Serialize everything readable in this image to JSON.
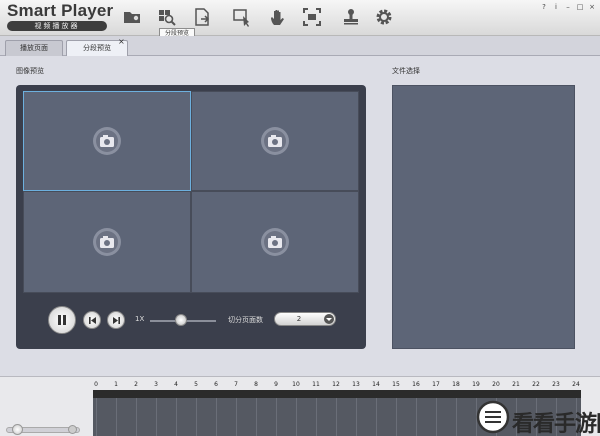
{
  "app": {
    "title": "Smart Player",
    "subtitle": "视频播放器"
  },
  "toolbar": {
    "tools": [
      "open-folder-icon",
      "segment-preview-icon",
      "export-file-icon",
      "select-window-icon",
      "hand-icon",
      "fullscreen-icon",
      "stamp-icon",
      "settings-icon"
    ],
    "tooltip": "分段预览"
  },
  "window_controls": [
    "?",
    "i",
    "–",
    "□",
    "×"
  ],
  "tabs": [
    {
      "label": "播放页面",
      "active": false
    },
    {
      "label": "分段预览",
      "active": true,
      "close": "×"
    }
  ],
  "main": {
    "preview_label": "图像预览",
    "file_label": "文件选择",
    "grid": {
      "cells": 4,
      "selected_index": 0
    }
  },
  "controls": {
    "speed_label": "1X",
    "speed_value_fraction": 0.47,
    "split_label": "切分页面数",
    "split_value": "2"
  },
  "timeline": {
    "ticks": [
      "0",
      "1",
      "2",
      "3",
      "4",
      "5",
      "6",
      "7",
      "8",
      "9",
      "10",
      "11",
      "12",
      "13",
      "14",
      "15",
      "16",
      "17",
      "18",
      "19",
      "20",
      "21",
      "22",
      "23",
      "24"
    ],
    "zoom_fraction": 0.15
  },
  "watermark": {
    "text": "看看手游网"
  },
  "colors": {
    "accent_selection": "#6db0de",
    "preview_bg": "#3b3f4c",
    "cell_bg": "#5d6577"
  }
}
